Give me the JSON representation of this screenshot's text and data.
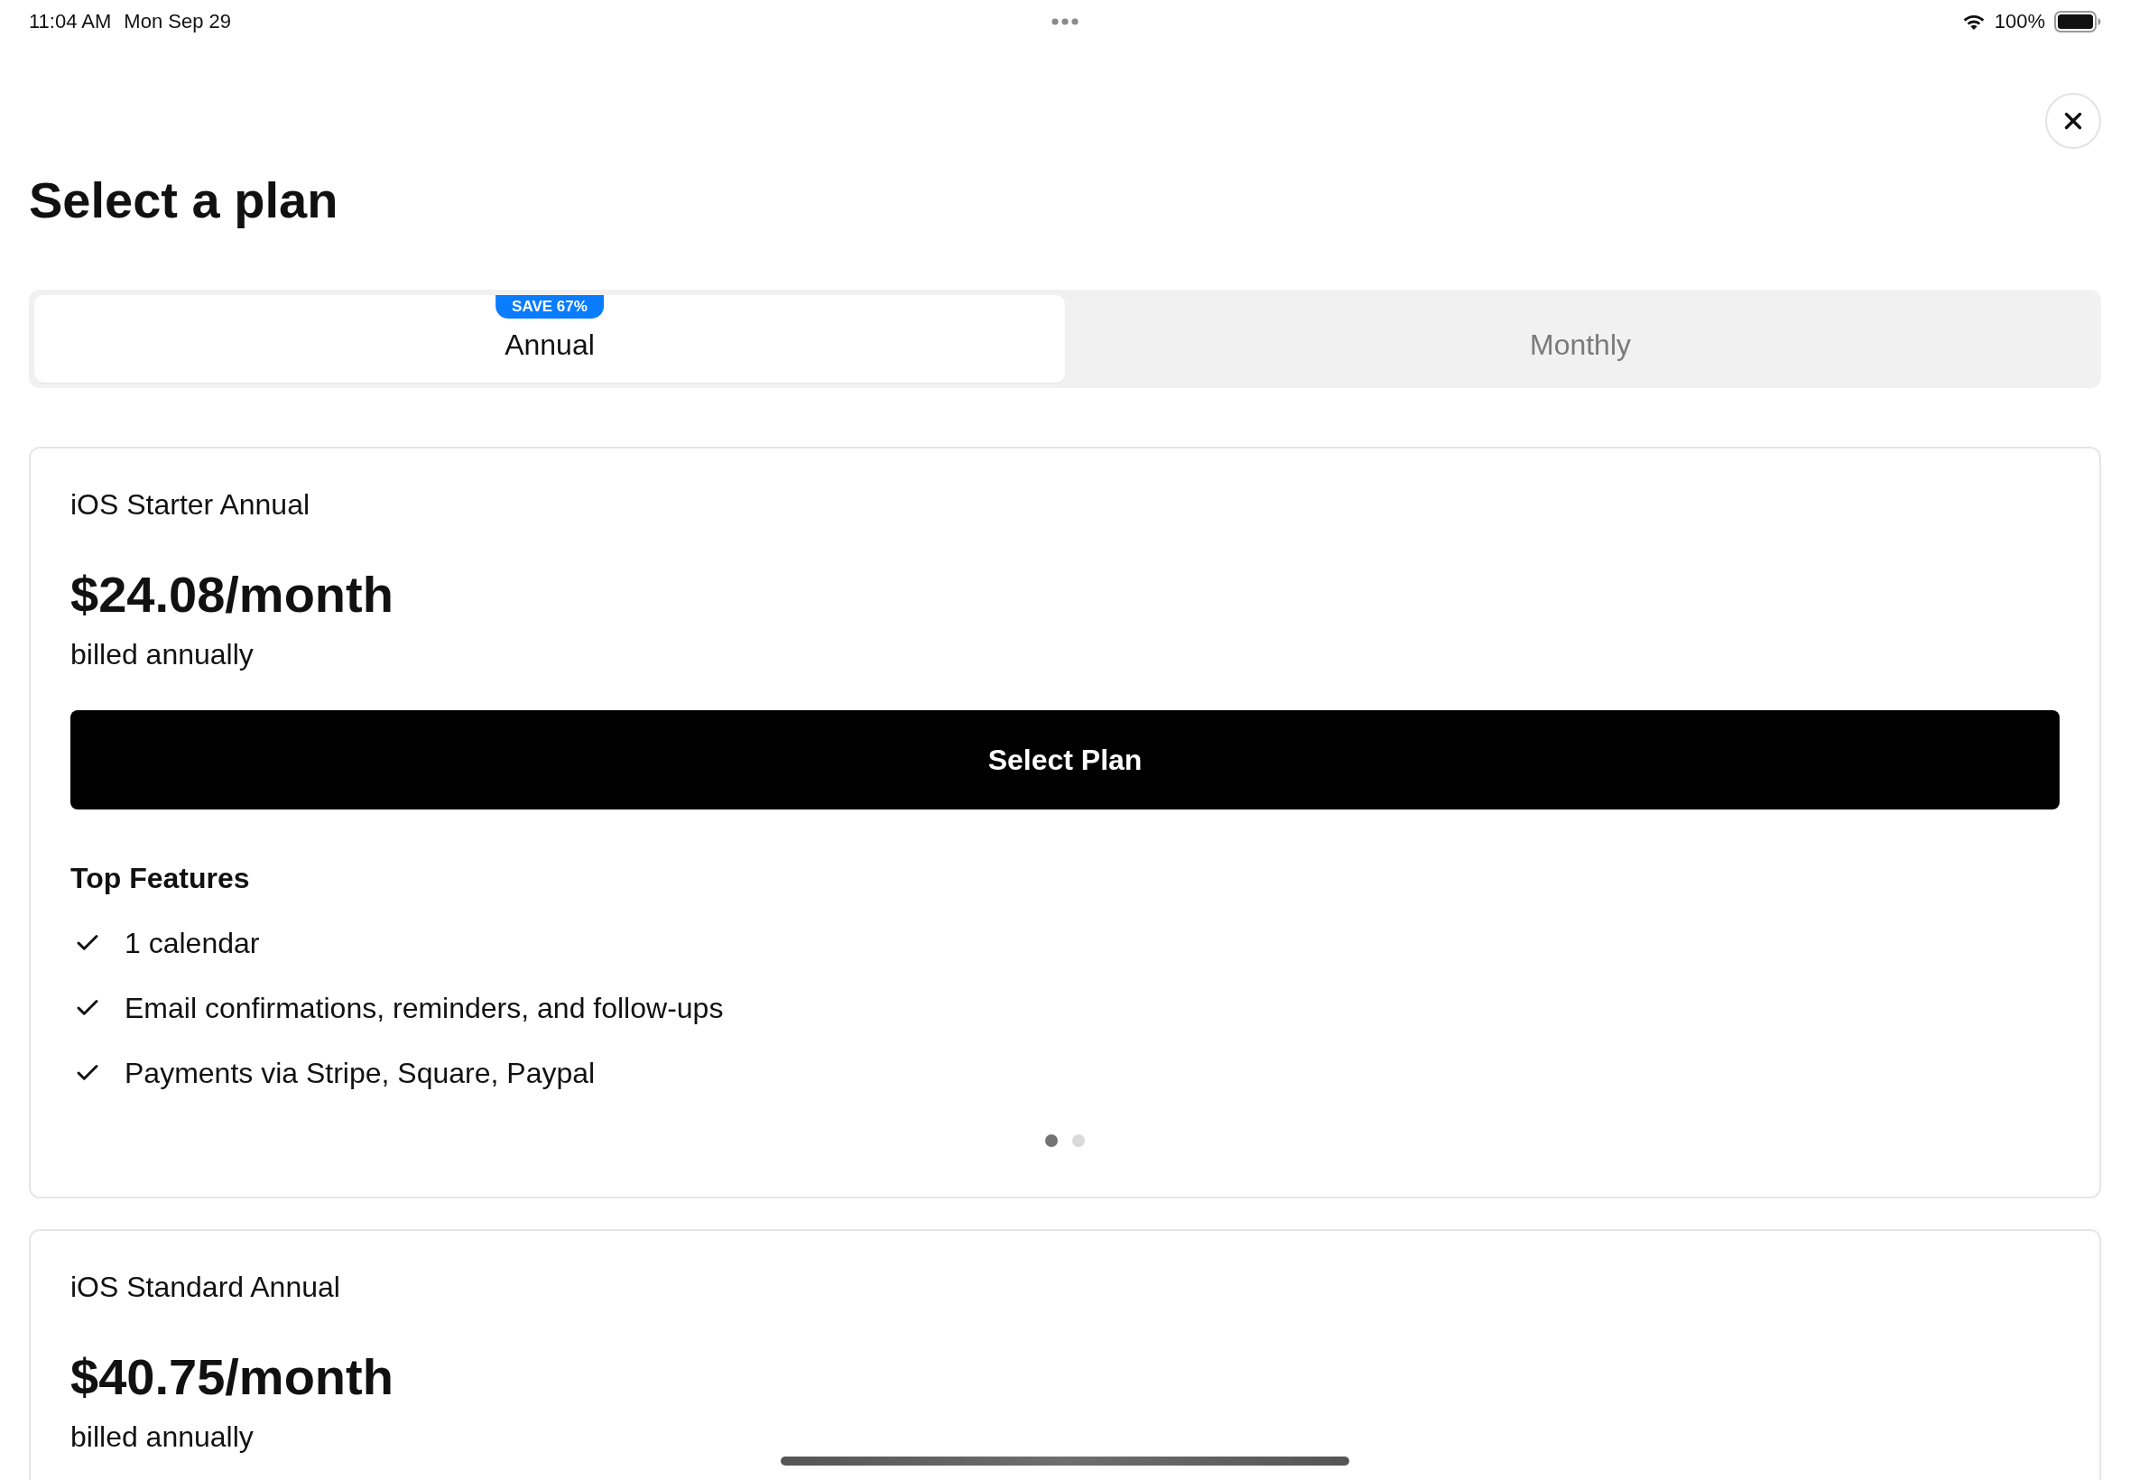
{
  "status_bar": {
    "time": "11:04 AM",
    "date": "Mon Sep 29",
    "battery": "100%"
  },
  "title": "Select a plan",
  "tabs": [
    {
      "label": "Annual",
      "selected": true,
      "badge": "SAVE 67%"
    },
    {
      "label": "Monthly",
      "selected": false
    }
  ],
  "plans": [
    {
      "name": "iOS Starter Annual",
      "price": "$24.08/month",
      "billing": "billed annually",
      "button": "Select Plan",
      "features_title": "Top Features",
      "features": [
        "1 calendar",
        "Email confirmations, reminders, and follow-ups",
        "Payments via Stripe, Square, Paypal"
      ],
      "pager": [
        {
          "selected": true
        },
        {
          "selected": false
        }
      ]
    },
    {
      "name": "iOS Standard Annual",
      "price": "$40.75/month",
      "billing": "billed annually"
    }
  ]
}
